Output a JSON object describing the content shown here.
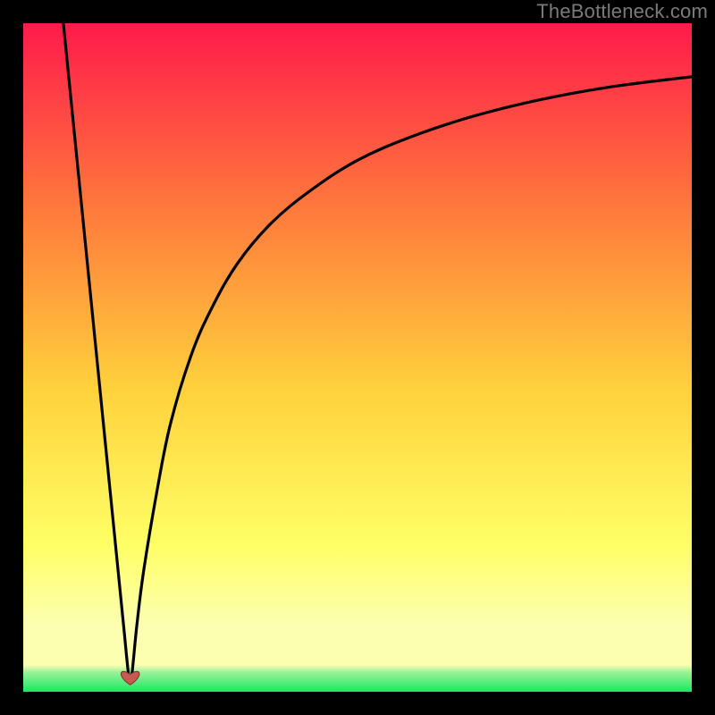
{
  "watermark": "TheBottleneck.com",
  "colors": {
    "top": "#ff1a4b",
    "mid_upper": "#ff7a3c",
    "mid": "#ffd23c",
    "mid_lower": "#ffff66",
    "pale_band": "#fcffb0",
    "green": "#17e860",
    "curve": "#000000",
    "heart": "#c65a53",
    "frame": "#000000"
  },
  "chart_data": {
    "type": "line",
    "title": "",
    "xlabel": "",
    "ylabel": "",
    "xlim": [
      0,
      100
    ],
    "ylim": [
      0,
      100
    ],
    "grid": false,
    "legend": false,
    "annotations": [
      {
        "kind": "marker",
        "shape": "heart",
        "x": 16,
        "y": 2
      }
    ],
    "series": [
      {
        "name": "left-branch",
        "x": [
          6,
          7,
          8,
          9,
          10,
          11,
          12,
          13,
          14,
          15,
          15.7,
          16
        ],
        "y": [
          100,
          90,
          80,
          70,
          60,
          50,
          40,
          30,
          20,
          10,
          3,
          1.5
        ]
      },
      {
        "name": "right-branch",
        "x": [
          16,
          16.3,
          17,
          18,
          20,
          22,
          25,
          28,
          32,
          37,
          43,
          50,
          58,
          67,
          77,
          88,
          100
        ],
        "y": [
          1.5,
          3,
          10,
          18,
          30,
          40,
          50,
          57,
          64,
          70,
          75,
          79.5,
          83,
          86,
          88.5,
          90.5,
          92
        ]
      }
    ]
  }
}
